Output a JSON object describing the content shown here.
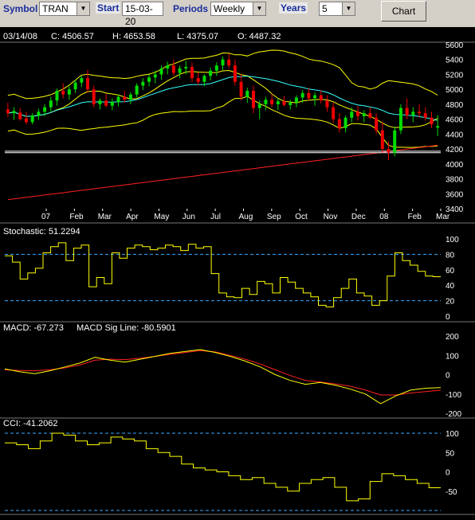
{
  "toolbar": {
    "symbol_label": "Symbol",
    "symbol_value": "TRAN",
    "start_label": "Start",
    "start_value": "15-03-20",
    "periods_label": "Periods",
    "periods_value": "Weekly",
    "years_label": "Years",
    "years_value": "5",
    "chart_button": "Chart"
  },
  "colors": {
    "background": "#000000",
    "up": "#00dd00",
    "down": "#ee0000",
    "band": "#ffff00",
    "ma_cyan": "#33ffff",
    "ma_red": "#ff2020",
    "dashed": "#3aa9ff",
    "white": "#ffffff",
    "toolbar_label": "#1a2e9c"
  },
  "chart_data": [
    {
      "type": "candlestick",
      "header": {
        "date": "03/14/08",
        "close": "C: 4506.57",
        "high": "H: 4653.58",
        "low": "L: 4375.07",
        "open": "O: 4487.32"
      },
      "ylim": [
        3400,
        5600
      ],
      "yticks": [
        "3400",
        "3600",
        "3800",
        "4000",
        "4200",
        "4400",
        "4600",
        "4800",
        "5000",
        "5200",
        "5400",
        "5600"
      ],
      "x_labels": [
        "07",
        "Feb",
        "Mar",
        "Apr",
        "May",
        "Jun",
        "Jul",
        "Aug",
        "Sep",
        "Oct",
        "Nov",
        "Dec",
        "08",
        "Feb",
        "Mar"
      ],
      "candles": [
        {
          "o": 4730,
          "h": 4820,
          "l": 4630,
          "c": 4680
        },
        {
          "o": 4680,
          "h": 4760,
          "l": 4590,
          "c": 4710
        },
        {
          "o": 4690,
          "h": 4750,
          "l": 4580,
          "c": 4600
        },
        {
          "o": 4610,
          "h": 4700,
          "l": 4530,
          "c": 4560
        },
        {
          "o": 4560,
          "h": 4680,
          "l": 4530,
          "c": 4650
        },
        {
          "o": 4650,
          "h": 4740,
          "l": 4590,
          "c": 4700
        },
        {
          "o": 4700,
          "h": 4800,
          "l": 4640,
          "c": 4760
        },
        {
          "o": 4760,
          "h": 4900,
          "l": 4700,
          "c": 4850
        },
        {
          "o": 4850,
          "h": 5010,
          "l": 4780,
          "c": 4980
        },
        {
          "o": 4980,
          "h": 5080,
          "l": 4880,
          "c": 4930
        },
        {
          "o": 4930,
          "h": 5040,
          "l": 4860,
          "c": 5000
        },
        {
          "o": 5000,
          "h": 5130,
          "l": 4950,
          "c": 5090
        },
        {
          "o": 5090,
          "h": 5180,
          "l": 5030,
          "c": 5150
        },
        {
          "o": 5150,
          "h": 5260,
          "l": 4950,
          "c": 5000
        },
        {
          "o": 5000,
          "h": 5050,
          "l": 4760,
          "c": 4800
        },
        {
          "o": 4800,
          "h": 4880,
          "l": 4730,
          "c": 4850
        },
        {
          "o": 4850,
          "h": 4940,
          "l": 4760,
          "c": 4780
        },
        {
          "o": 4780,
          "h": 4880,
          "l": 4720,
          "c": 4830
        },
        {
          "o": 4830,
          "h": 4930,
          "l": 4770,
          "c": 4900
        },
        {
          "o": 4900,
          "h": 4980,
          "l": 4820,
          "c": 4860
        },
        {
          "o": 4860,
          "h": 4960,
          "l": 4800,
          "c": 4930
        },
        {
          "o": 4930,
          "h": 5080,
          "l": 4890,
          "c": 5050
        },
        {
          "o": 5050,
          "h": 5150,
          "l": 4990,
          "c": 5100
        },
        {
          "o": 5100,
          "h": 5200,
          "l": 5040,
          "c": 5160
        },
        {
          "o": 5160,
          "h": 5250,
          "l": 5080,
          "c": 5200
        },
        {
          "o": 5200,
          "h": 5320,
          "l": 5130,
          "c": 5280
        },
        {
          "o": 5280,
          "h": 5370,
          "l": 5200,
          "c": 5320
        },
        {
          "o": 5320,
          "h": 5400,
          "l": 5180,
          "c": 5220
        },
        {
          "o": 5220,
          "h": 5320,
          "l": 5150,
          "c": 5280
        },
        {
          "o": 5280,
          "h": 5380,
          "l": 5200,
          "c": 5300
        },
        {
          "o": 5300,
          "h": 5360,
          "l": 5100,
          "c": 5150
        },
        {
          "o": 5150,
          "h": 5230,
          "l": 5060,
          "c": 5100
        },
        {
          "o": 5100,
          "h": 5200,
          "l": 5040,
          "c": 5180
        },
        {
          "o": 5180,
          "h": 5290,
          "l": 5120,
          "c": 5250
        },
        {
          "o": 5250,
          "h": 5360,
          "l": 5180,
          "c": 5320
        },
        {
          "o": 5320,
          "h": 5440,
          "l": 5260,
          "c": 5400
        },
        {
          "o": 5400,
          "h": 5480,
          "l": 5280,
          "c": 5320
        },
        {
          "o": 5320,
          "h": 5400,
          "l": 5050,
          "c": 5100
        },
        {
          "o": 5100,
          "h": 5200,
          "l": 4850,
          "c": 4900
        },
        {
          "o": 4900,
          "h": 5020,
          "l": 4820,
          "c": 4980
        },
        {
          "o": 4980,
          "h": 5050,
          "l": 4680,
          "c": 4750
        },
        {
          "o": 4750,
          "h": 4850,
          "l": 4600,
          "c": 4800
        },
        {
          "o": 4800,
          "h": 4900,
          "l": 4720,
          "c": 4860
        },
        {
          "o": 4860,
          "h": 4940,
          "l": 4760,
          "c": 4800
        },
        {
          "o": 4800,
          "h": 4880,
          "l": 4720,
          "c": 4840
        },
        {
          "o": 4840,
          "h": 4910,
          "l": 4770,
          "c": 4790
        },
        {
          "o": 4790,
          "h": 4860,
          "l": 4730,
          "c": 4820
        },
        {
          "o": 4820,
          "h": 4920,
          "l": 4760,
          "c": 4890
        },
        {
          "o": 4890,
          "h": 4990,
          "l": 4820,
          "c": 4950
        },
        {
          "o": 4950,
          "h": 5020,
          "l": 4850,
          "c": 4880
        },
        {
          "o": 4880,
          "h": 4960,
          "l": 4780,
          "c": 4920
        },
        {
          "o": 4920,
          "h": 4990,
          "l": 4810,
          "c": 4850
        },
        {
          "o": 4850,
          "h": 4920,
          "l": 4700,
          "c": 4760
        },
        {
          "o": 4760,
          "h": 4820,
          "l": 4550,
          "c": 4600
        },
        {
          "o": 4600,
          "h": 4680,
          "l": 4420,
          "c": 4480
        },
        {
          "o": 4480,
          "h": 4650,
          "l": 4420,
          "c": 4620
        },
        {
          "o": 4620,
          "h": 4760,
          "l": 4560,
          "c": 4700
        },
        {
          "o": 4700,
          "h": 4780,
          "l": 4580,
          "c": 4640
        },
        {
          "o": 4640,
          "h": 4720,
          "l": 4560,
          "c": 4680
        },
        {
          "o": 4680,
          "h": 4760,
          "l": 4600,
          "c": 4620
        },
        {
          "o": 4620,
          "h": 4680,
          "l": 4400,
          "c": 4450
        },
        {
          "o": 4450,
          "h": 4560,
          "l": 4150,
          "c": 4200
        },
        {
          "o": 4200,
          "h": 4300,
          "l": 4050,
          "c": 4150
        },
        {
          "o": 4150,
          "h": 4500,
          "l": 4100,
          "c": 4450
        },
        {
          "o": 4450,
          "h": 4800,
          "l": 4400,
          "c": 4750
        },
        {
          "o": 4750,
          "h": 4880,
          "l": 4600,
          "c": 4650
        },
        {
          "o": 4650,
          "h": 4760,
          "l": 4560,
          "c": 4700
        },
        {
          "o": 4700,
          "h": 4800,
          "l": 4620,
          "c": 4680
        },
        {
          "o": 4680,
          "h": 4760,
          "l": 4580,
          "c": 4620
        },
        {
          "o": 4620,
          "h": 4700,
          "l": 4480,
          "c": 4530
        },
        {
          "o": 4487.32,
          "h": 4653.58,
          "l": 4375.07,
          "c": 4506.57
        }
      ]
    },
    {
      "type": "line",
      "title": "Stochastic: 51.2294",
      "ylim": [
        0,
        100
      ],
      "yticks": [
        "0",
        "20",
        "40",
        "60",
        "80",
        "100"
      ],
      "reference_lines": [
        20,
        80
      ],
      "values": [
        78,
        70,
        48,
        56,
        62,
        82,
        90,
        95,
        72,
        88,
        92,
        38,
        50,
        42,
        82,
        75,
        88,
        92,
        90,
        86,
        88,
        92,
        90,
        85,
        93,
        88,
        90,
        55,
        30,
        25,
        24,
        36,
        28,
        45,
        42,
        30,
        50,
        44,
        36,
        30,
        25,
        14,
        12,
        24,
        36,
        48,
        30,
        26,
        14,
        20,
        52,
        82,
        72,
        66,
        58,
        52,
        51
      ]
    },
    {
      "type": "line",
      "title": "MACD: -67.273",
      "signal_title": "MACD Sig Line: -80.5901",
      "ylim": [
        -200,
        200
      ],
      "yticks": [
        "200",
        "100",
        "0",
        "-100",
        "-200"
      ],
      "series": [
        {
          "name": "MACD",
          "values": [
            30,
            15,
            5,
            20,
            40,
            60,
            90,
            75,
            65,
            80,
            95,
            110,
            120,
            130,
            115,
            95,
            70,
            40,
            0,
            -30,
            -50,
            -40,
            -55,
            -75,
            -100,
            -150,
            -110,
            -80,
            -70,
            -67.273
          ]
        },
        {
          "name": "MACD Sig Line",
          "values": [
            25,
            22,
            20,
            25,
            35,
            50,
            75,
            80,
            78,
            85,
            95,
            105,
            115,
            125,
            118,
            100,
            80,
            55,
            25,
            -5,
            -30,
            -38,
            -48,
            -60,
            -80,
            -105,
            -105,
            -95,
            -88,
            -80.5901
          ]
        }
      ]
    },
    {
      "type": "line",
      "title": "CCI: -41.2062",
      "ylim": [
        -100,
        100
      ],
      "yticks": [
        "100",
        "50",
        "0",
        "-50"
      ],
      "reference_lines": [
        -100,
        100
      ],
      "values": [
        75,
        70,
        60,
        80,
        100,
        95,
        80,
        70,
        75,
        90,
        85,
        80,
        60,
        50,
        40,
        20,
        10,
        5,
        0,
        -10,
        -20,
        -15,
        -30,
        -40,
        -50,
        -30,
        -20,
        -15,
        -40,
        -75,
        -70,
        -25,
        -5,
        -10,
        -20,
        -30,
        -41.2062
      ]
    }
  ]
}
